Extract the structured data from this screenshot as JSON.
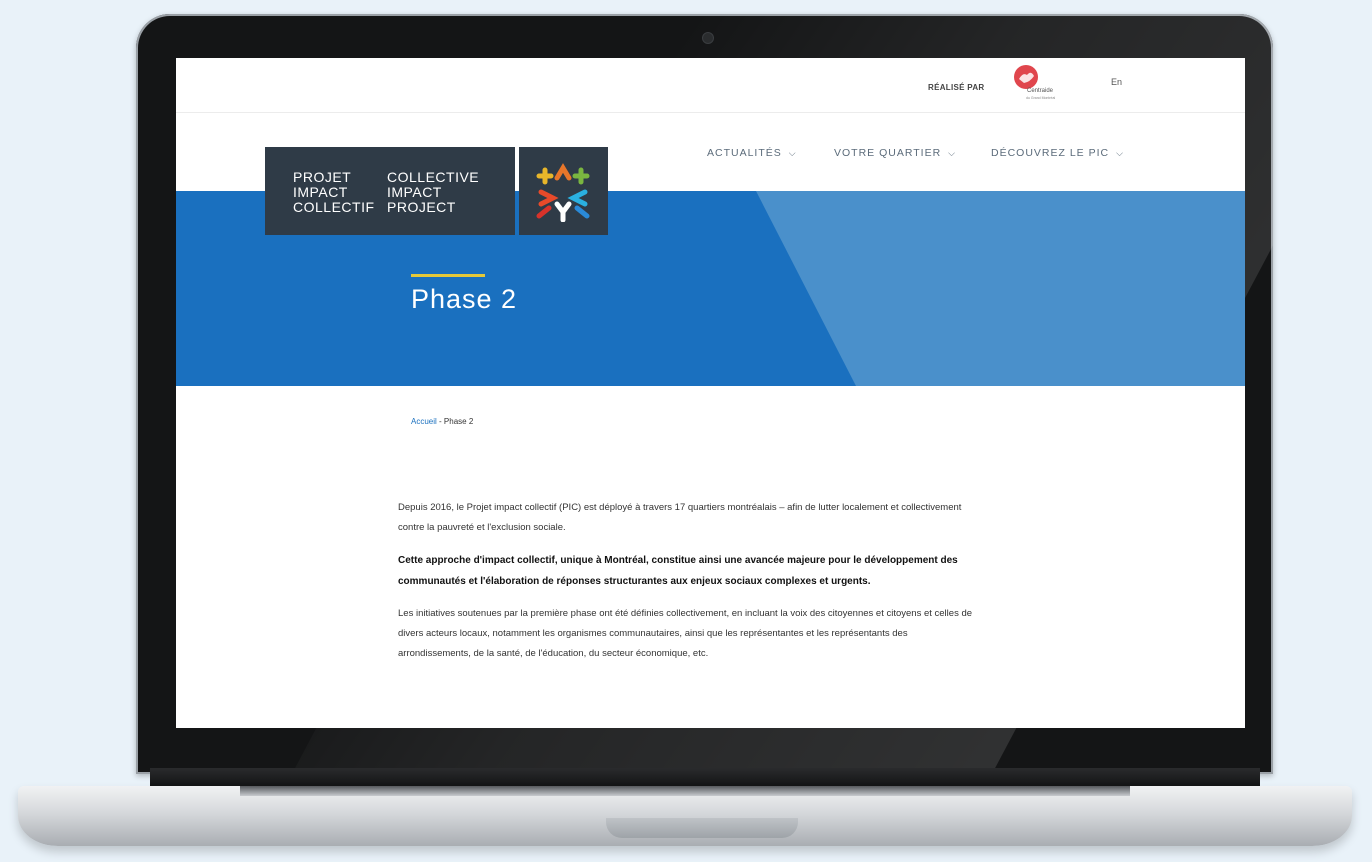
{
  "topbar": {
    "realise_label": "RÉALISÉ PAR",
    "partner_name": "Centraide",
    "partner_sub": "du Grand Montréal",
    "language": "En"
  },
  "logo": {
    "col1": [
      "PROJET",
      "IMPACT",
      "COLLECTIF"
    ],
    "col2": [
      "COLLECTIVE",
      "IMPACT",
      "PROJECT"
    ]
  },
  "nav": {
    "items": [
      {
        "label": "ACTUALITÉS"
      },
      {
        "label": "VOTRE QUARTIER"
      },
      {
        "label": "DÉCOUVREZ LE PIC"
      }
    ]
  },
  "hero": {
    "title": "Phase 2"
  },
  "breadcrumb": {
    "home": "Accueil",
    "separator": " - ",
    "current": "Phase 2"
  },
  "content": {
    "p1": "Depuis 2016, le Projet impact collectif (PIC) est déployé à travers 17 quartiers montréalais – afin de lutter localement et collectivement contre la pauvreté et l'exclusion sociale.",
    "p2": "Cette approche d'impact collectif, unique à Montréal, constitue ainsi une avancée majeure pour le développement des communautés et l'élaboration de réponses structurantes aux enjeux sociaux complexes et urgents.",
    "p3": "Les initiatives soutenues par la première phase ont été définies collectivement, en incluant la voix des citoyennes et citoyens et celles de divers acteurs locaux, notamment les organismes communautaires, ainsi que les représentantes et les représentants des arrondissements, de la santé, de l'éducation, du secteur économique, etc."
  },
  "colors": {
    "hero_blue": "#1a70bf",
    "hero_light": "#4a90cb",
    "logo_bg": "#2f3b47",
    "accent_yellow": "#e5c93a"
  },
  "icons": [
    "centraide-hand-icon",
    "pic-people-icon",
    "chevron-down-icon"
  ]
}
